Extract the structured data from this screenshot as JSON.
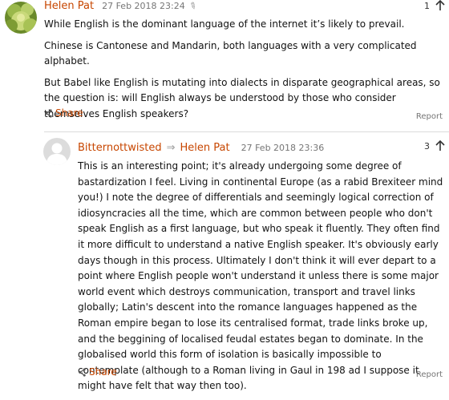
{
  "comments": [
    {
      "author": "Helen Pat",
      "timestamp": "27 Feb 2018 23:24",
      "votes": "1",
      "paragraphs": [
        "While English is the dominant language of the internet it’s likely to prevail.",
        "Chinese is Cantonese and Mandarin, both languages with a very complicated alphabet.",
        "But Babel like English is mutating into dialects in disparate geographical areas, so the question is: will English always be understood by those who consider themselves English speakers?"
      ],
      "share_label": "Share",
      "report_label": "Report"
    },
    {
      "author": "Bitternottwisted",
      "reply_to": "Helen Pat",
      "timestamp": "27 Feb 2018 23:36",
      "votes": "3",
      "paragraphs": [
        "This is an interesting point; it's already undergoing some degree of bastardization I feel. Living in continental Europe (as a rabid Brexiteer mind you!) I note the degree of differentials and seemingly logical correction of idiosyncracies all the time, which are common between people who don't speak English as a first language, but who speak it fluently. They often find it more difficult to understand a native English speaker. It's obviously early days though in this process. Ultimately I don't think it will ever depart to a point where English people won't understand it unless there is some major world event which destroys communication, transport and travel links globally; Latin's descent into the romance languages happened as the Roman empire began to lose its centralised format, trade links broke up, and the beggining of localised feudal estates began to dominate. In the globalised world this form of isolation is basically impossible to contemplate (although to a Roman living in Gaul in 198 ad I suppose it might have felt that way then too)."
      ],
      "share_label": "Share",
      "report_label": "Report"
    }
  ],
  "icons": {
    "share": "share-icon",
    "upvote": "upvote-arrow-icon",
    "reply_arrow": "reply-arrow-icon",
    "edit": "pencil-icon"
  },
  "colors": {
    "accent": "#c74600",
    "muted": "#767676"
  }
}
